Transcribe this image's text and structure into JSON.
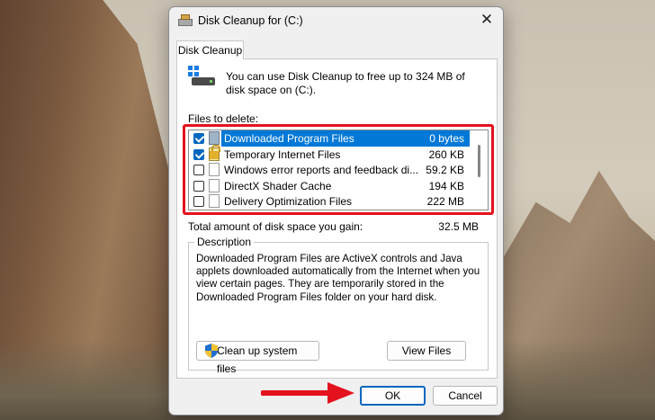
{
  "dialog": {
    "title": "Disk Cleanup for  (C:)",
    "close_label": "✕",
    "tab_label": "Disk Cleanup",
    "info_text": "You can use Disk Cleanup to free up to 324 MB of disk space on  (C:).",
    "files_label": "Files to delete:",
    "files": [
      {
        "name": "Downloaded Program Files",
        "size": "0 bytes",
        "checked": true,
        "selected": true
      },
      {
        "name": "Temporary Internet Files",
        "size": "260 KB",
        "checked": true,
        "selected": false
      },
      {
        "name": "Windows error reports and feedback di...",
        "size": "59.2 KB",
        "checked": false,
        "selected": false
      },
      {
        "name": "DirectX Shader Cache",
        "size": "194 KB",
        "checked": false,
        "selected": false
      },
      {
        "name": "Delivery Optimization Files",
        "size": "222 MB",
        "checked": false,
        "selected": false
      }
    ],
    "total_label": "Total amount of disk space you gain:",
    "total_value": "32.5 MB",
    "description_legend": "Description",
    "description_text": "Downloaded Program Files are ActiveX controls and Java applets downloaded automatically from the Internet when you view certain pages. They are temporarily stored in the Downloaded Program Files folder on your hard disk.",
    "cleanup_button": "Clean up system files",
    "view_files_button": "View Files",
    "ok_button": "OK",
    "cancel_button": "Cancel"
  },
  "colors": {
    "accent": "#0078d7",
    "highlight_frame": "#e4121d",
    "annotation_arrow": "#e4121d"
  }
}
